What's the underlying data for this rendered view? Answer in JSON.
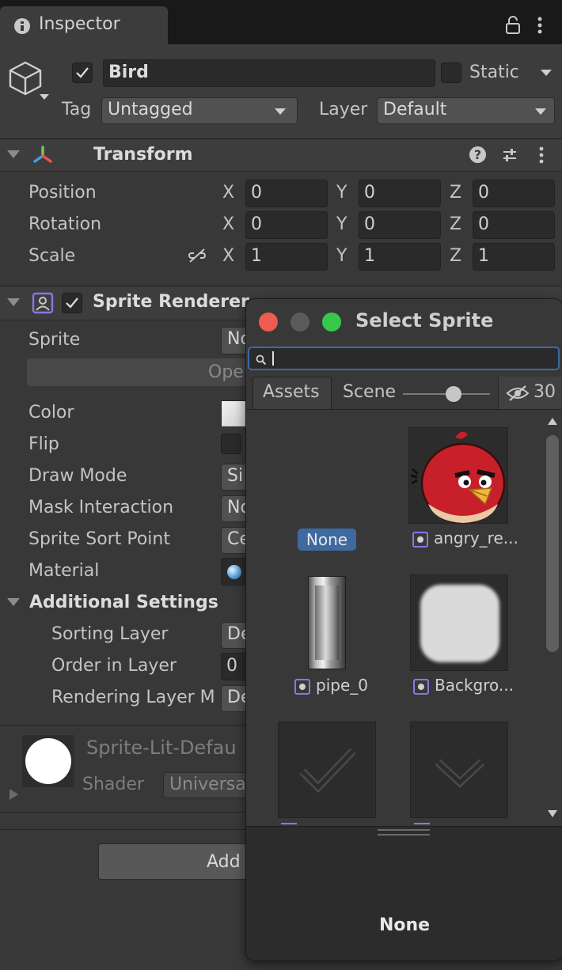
{
  "window": {
    "tab_title": "Inspector"
  },
  "object": {
    "name": "Bird",
    "static_label": "Static",
    "tag_label": "Tag",
    "tag_value": "Untagged",
    "layer_label": "Layer",
    "layer_value": "Default"
  },
  "transform": {
    "title": "Transform",
    "axis_x": "X",
    "axis_y": "Y",
    "axis_z": "Z",
    "rows": [
      {
        "label": "Position",
        "x": "0",
        "y": "0",
        "z": "0"
      },
      {
        "label": "Rotation",
        "x": "0",
        "y": "0",
        "z": "0"
      },
      {
        "label": "Scale",
        "x": "1",
        "y": "1",
        "z": "1"
      }
    ]
  },
  "sprite_renderer": {
    "title": "Sprite Renderer",
    "sprite_label": "Sprite",
    "sprite_value": "No",
    "open_button": "Ope",
    "color_label": "Color",
    "flip_label": "Flip",
    "draw_mode_label": "Draw Mode",
    "draw_mode_value": "Si",
    "mask_label": "Mask Interaction",
    "mask_value": "No",
    "sort_point_label": "Sprite Sort Point",
    "sort_point_value": "Ce",
    "material_label": "Material",
    "additional_title": "Additional Settings",
    "sorting_layer_label": "Sorting Layer",
    "sorting_layer_value": "De",
    "order_label": "Order in Layer",
    "order_value": "0",
    "rendering_layer_label": "Rendering Layer M",
    "rendering_layer_value": "De"
  },
  "material": {
    "name": "Sprite-Lit-Defau",
    "shader_label": "Shader",
    "shader_value": "Universa"
  },
  "add_component": {
    "label": "Add"
  },
  "picker": {
    "title": "Select Sprite",
    "search_value": "",
    "tab_assets": "Assets",
    "tab_scene": "Scene",
    "hidden_count": "30",
    "zoom_level": 0.6,
    "items": [
      {
        "label": "None",
        "selected": true
      },
      {
        "label": "angry_re..."
      },
      {
        "label": "pipe_0"
      },
      {
        "label": "Backgro..."
      }
    ],
    "footer_label": "None"
  },
  "colors": {
    "panel": "#383838",
    "accent_blue": "#3e6aa0",
    "close_red": "#ee5b51",
    "zoom_green": "#37c84a",
    "sprite_purple": "#8a76e6"
  }
}
